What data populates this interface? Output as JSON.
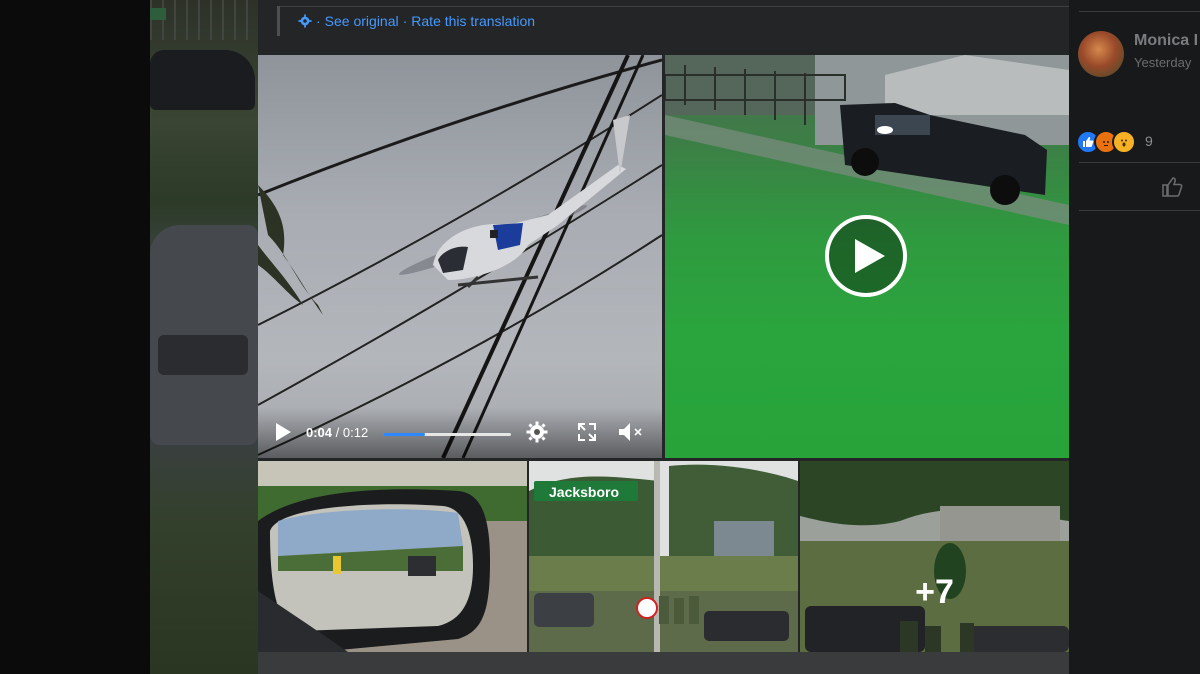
{
  "translation": {
    "see_original": "See original",
    "separator": "·",
    "rate": "Rate this translation"
  },
  "video_player": {
    "current_time": "0:04",
    "time_separator": "/",
    "duration": "0:12",
    "progress_fraction": 0.33
  },
  "photo_grid": {
    "more_count": "+7"
  },
  "sidebar": {
    "author_name": "Monica I",
    "timestamp": "Yesterday",
    "reaction_count": "9",
    "reactions": [
      "like",
      "angry",
      "wow"
    ]
  },
  "colors": {
    "link": "#4599ff",
    "panel": "#242526",
    "progress": "#2d88ff"
  }
}
